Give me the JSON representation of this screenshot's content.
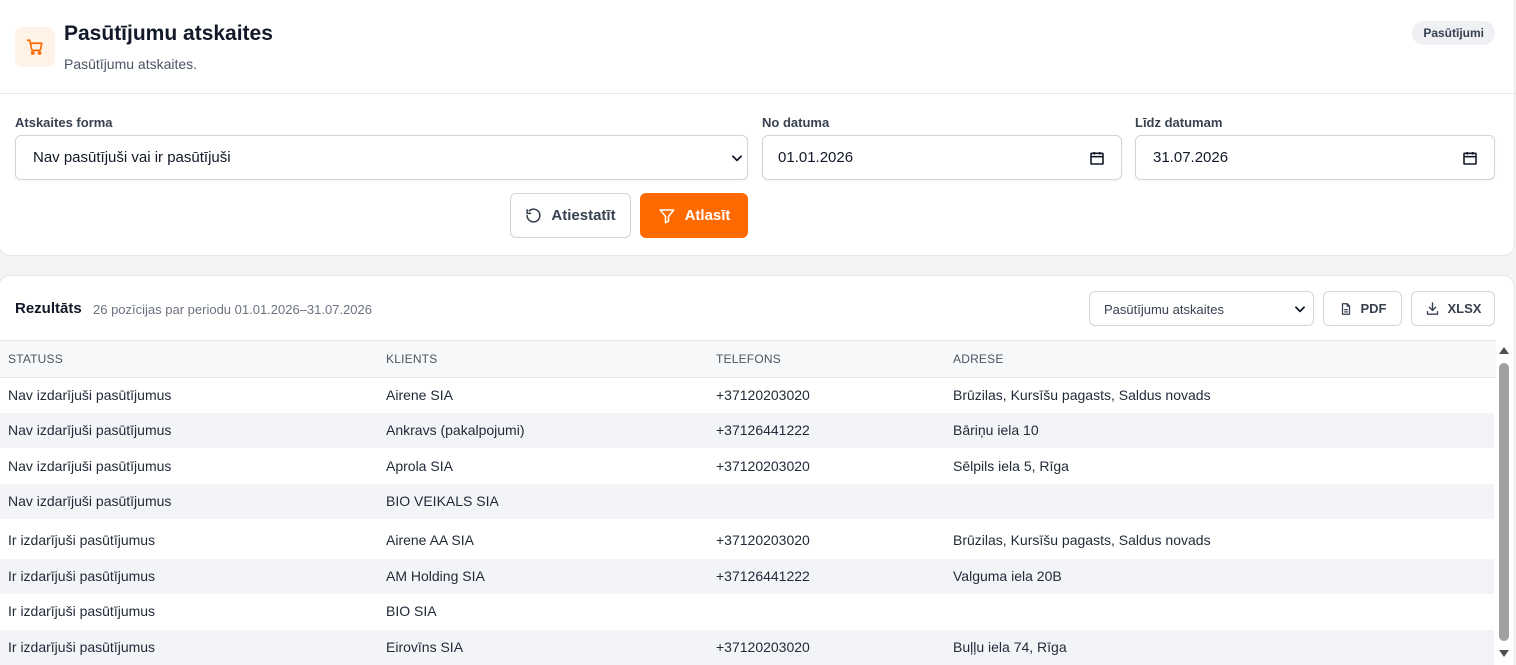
{
  "header": {
    "title": "Pasūtījumu atskaites",
    "subtitle": "Pasūtījumu atskaites.",
    "badge": "Pasūtījumi",
    "icon": "cart-icon",
    "accent": "#ff6a00"
  },
  "filters": {
    "report_form_label": "Atskaites forma",
    "report_form_value": "Nav pasūtījuši vai ir pasūtījuši",
    "from_label": "No datuma",
    "from_value": "01.01.2026",
    "to_label": "Līdz datumam",
    "to_value": "31.07.2026",
    "reset_label": "Atiestatīt",
    "apply_label": "Atlasīt"
  },
  "results": {
    "title": "Rezultāts",
    "summary": "26 pozīcijas par periodu 01.01.2026–31.07.2026",
    "view_select_value": "Pasūtījumu atskaites",
    "pdf_label": "PDF",
    "xlsx_label": "XLSX",
    "columns": [
      "STATUSS",
      "KLIENTS",
      "TELEFONS",
      "ADRESE"
    ],
    "rows": [
      [
        "Nav izdarījuši pasūtījumus",
        "Airene SIA",
        "+37120203020",
        "Brūzilas, Kursīšu pagasts, Saldus novads"
      ],
      [
        "Nav izdarījuši pasūtījumus",
        "Ankravs (pakalpojumi)",
        "+37126441222",
        "Bāriņu iela 10"
      ],
      [
        "Nav izdarījuši pasūtījumus",
        "Aprola SIA",
        "+37120203020",
        "Sēlpils iela 5, Rīga"
      ],
      [
        "Nav izdarījuši pasūtījumus",
        "BIO VEIKALS SIA",
        "",
        ""
      ],
      [
        "Ir izdarījuši pasūtījumus",
        "Airene AA SIA",
        "+37120203020",
        "Brūzilas, Kursīšu pagasts, Saldus novads"
      ],
      [
        "Ir izdarījuši pasūtījumus",
        "AM Holding SIA",
        "+37126441222",
        "Valguma iela 20B"
      ],
      [
        "Ir izdarījuši pasūtījumus",
        "BIO SIA",
        "",
        ""
      ],
      [
        "Ir izdarījuši pasūtījumus",
        "Eirovīns SIA",
        "+37120203020",
        "Buļļu iela 74, Rīga"
      ]
    ]
  }
}
